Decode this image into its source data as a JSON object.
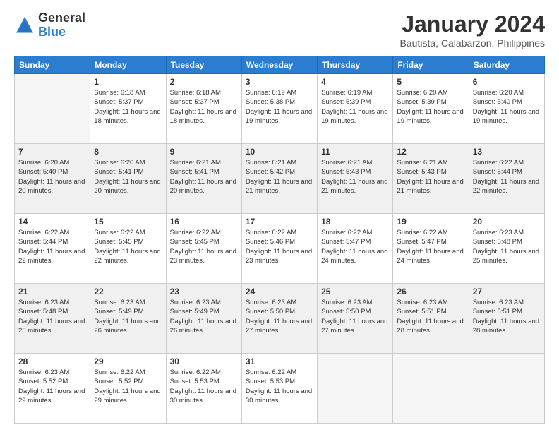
{
  "logo": {
    "general": "General",
    "blue": "Blue"
  },
  "title": "January 2024",
  "location": "Bautista, Calabarzon, Philippines",
  "days_of_week": [
    "Sunday",
    "Monday",
    "Tuesday",
    "Wednesday",
    "Thursday",
    "Friday",
    "Saturday"
  ],
  "weeks": [
    [
      {
        "day": "",
        "empty": true
      },
      {
        "day": "1",
        "sunrise": "6:18 AM",
        "sunset": "5:37 PM",
        "daylight": "11 hours and 18 minutes."
      },
      {
        "day": "2",
        "sunrise": "6:18 AM",
        "sunset": "5:37 PM",
        "daylight": "11 hours and 18 minutes."
      },
      {
        "day": "3",
        "sunrise": "6:19 AM",
        "sunset": "5:38 PM",
        "daylight": "11 hours and 19 minutes."
      },
      {
        "day": "4",
        "sunrise": "6:19 AM",
        "sunset": "5:39 PM",
        "daylight": "11 hours and 19 minutes."
      },
      {
        "day": "5",
        "sunrise": "6:20 AM",
        "sunset": "5:39 PM",
        "daylight": "11 hours and 19 minutes."
      },
      {
        "day": "6",
        "sunrise": "6:20 AM",
        "sunset": "5:40 PM",
        "daylight": "11 hours and 19 minutes."
      }
    ],
    [
      {
        "day": "7",
        "sunrise": "6:20 AM",
        "sunset": "5:40 PM",
        "daylight": "11 hours and 20 minutes."
      },
      {
        "day": "8",
        "sunrise": "6:20 AM",
        "sunset": "5:41 PM",
        "daylight": "11 hours and 20 minutes."
      },
      {
        "day": "9",
        "sunrise": "6:21 AM",
        "sunset": "5:41 PM",
        "daylight": "11 hours and 20 minutes."
      },
      {
        "day": "10",
        "sunrise": "6:21 AM",
        "sunset": "5:42 PM",
        "daylight": "11 hours and 21 minutes."
      },
      {
        "day": "11",
        "sunrise": "6:21 AM",
        "sunset": "5:43 PM",
        "daylight": "11 hours and 21 minutes."
      },
      {
        "day": "12",
        "sunrise": "6:21 AM",
        "sunset": "5:43 PM",
        "daylight": "11 hours and 21 minutes."
      },
      {
        "day": "13",
        "sunrise": "6:22 AM",
        "sunset": "5:44 PM",
        "daylight": "11 hours and 22 minutes."
      }
    ],
    [
      {
        "day": "14",
        "sunrise": "6:22 AM",
        "sunset": "5:44 PM",
        "daylight": "11 hours and 22 minutes."
      },
      {
        "day": "15",
        "sunrise": "6:22 AM",
        "sunset": "5:45 PM",
        "daylight": "11 hours and 22 minutes."
      },
      {
        "day": "16",
        "sunrise": "6:22 AM",
        "sunset": "5:45 PM",
        "daylight": "11 hours and 23 minutes."
      },
      {
        "day": "17",
        "sunrise": "6:22 AM",
        "sunset": "5:46 PM",
        "daylight": "11 hours and 23 minutes."
      },
      {
        "day": "18",
        "sunrise": "6:22 AM",
        "sunset": "5:47 PM",
        "daylight": "11 hours and 24 minutes."
      },
      {
        "day": "19",
        "sunrise": "6:22 AM",
        "sunset": "5:47 PM",
        "daylight": "11 hours and 24 minutes."
      },
      {
        "day": "20",
        "sunrise": "6:23 AM",
        "sunset": "5:48 PM",
        "daylight": "11 hours and 25 minutes."
      }
    ],
    [
      {
        "day": "21",
        "sunrise": "6:23 AM",
        "sunset": "5:48 PM",
        "daylight": "11 hours and 25 minutes."
      },
      {
        "day": "22",
        "sunrise": "6:23 AM",
        "sunset": "5:49 PM",
        "daylight": "11 hours and 26 minutes."
      },
      {
        "day": "23",
        "sunrise": "6:23 AM",
        "sunset": "5:49 PM",
        "daylight": "11 hours and 26 minutes."
      },
      {
        "day": "24",
        "sunrise": "6:23 AM",
        "sunset": "5:50 PM",
        "daylight": "11 hours and 27 minutes."
      },
      {
        "day": "25",
        "sunrise": "6:23 AM",
        "sunset": "5:50 PM",
        "daylight": "11 hours and 27 minutes."
      },
      {
        "day": "26",
        "sunrise": "6:23 AM",
        "sunset": "5:51 PM",
        "daylight": "11 hours and 28 minutes."
      },
      {
        "day": "27",
        "sunrise": "6:23 AM",
        "sunset": "5:51 PM",
        "daylight": "11 hours and 28 minutes."
      }
    ],
    [
      {
        "day": "28",
        "sunrise": "6:23 AM",
        "sunset": "5:52 PM",
        "daylight": "11 hours and 29 minutes."
      },
      {
        "day": "29",
        "sunrise": "6:22 AM",
        "sunset": "5:52 PM",
        "daylight": "11 hours and 29 minutes."
      },
      {
        "day": "30",
        "sunrise": "6:22 AM",
        "sunset": "5:53 PM",
        "daylight": "11 hours and 30 minutes."
      },
      {
        "day": "31",
        "sunrise": "6:22 AM",
        "sunset": "5:53 PM",
        "daylight": "11 hours and 30 minutes."
      },
      {
        "day": "",
        "empty": true
      },
      {
        "day": "",
        "empty": true
      },
      {
        "day": "",
        "empty": true
      }
    ]
  ]
}
